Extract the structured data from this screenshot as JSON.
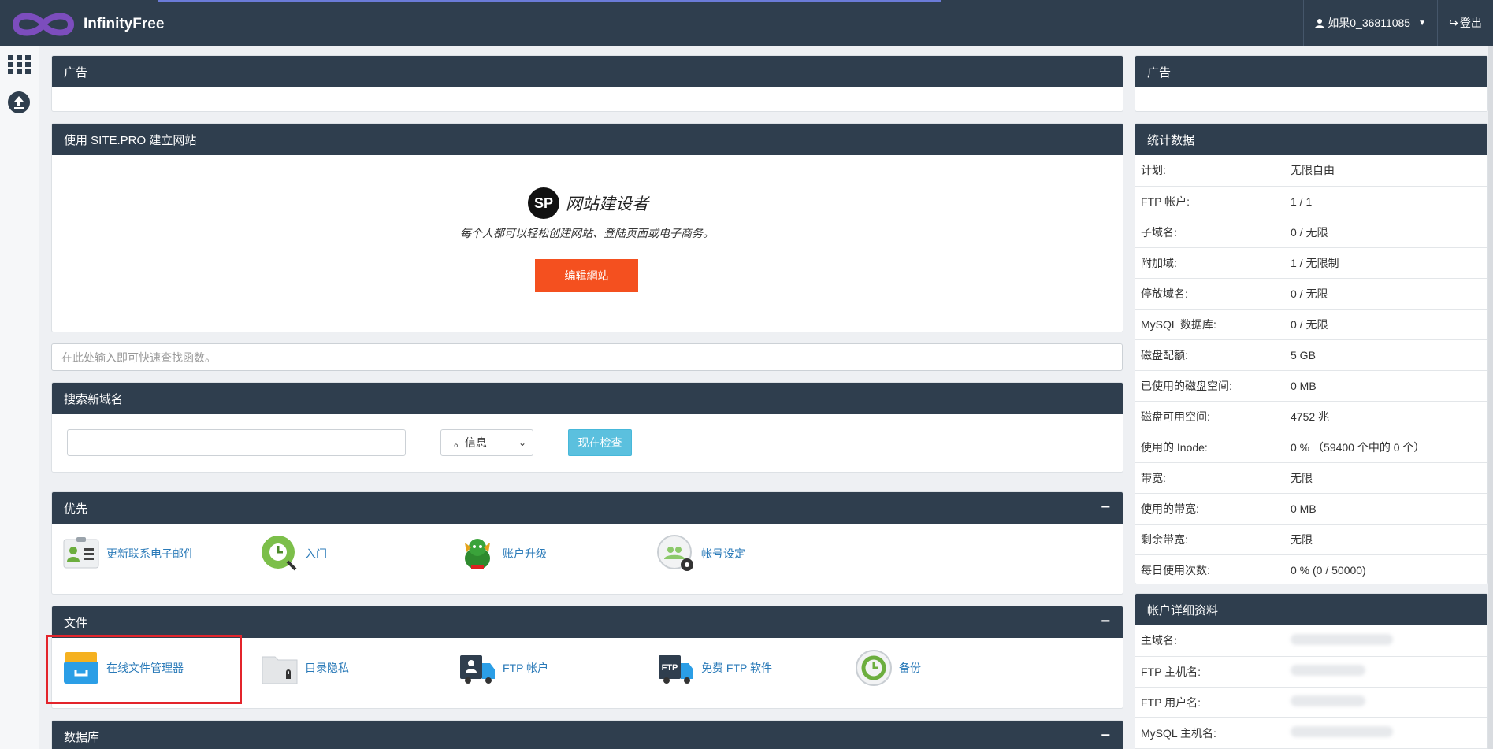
{
  "header": {
    "brand": "InfinityFree",
    "user": "如果0_36811085",
    "logout": "登出"
  },
  "ads_left": {
    "title": "广告"
  },
  "ads_right": {
    "title": "广告"
  },
  "sitepro": {
    "title": "使用 SITE.PRO 建立网站",
    "badge": "SP",
    "name": "网站建设者",
    "tagline": "每个人都可以轻松创建网站、登陆页面或电子商务。",
    "button": "编辑網站"
  },
  "quick_search": {
    "placeholder": "在此处输入即可快速查找函数。"
  },
  "domain_search": {
    "title": "搜索新域名",
    "input_value": "",
    "select_value": "。信息",
    "button": "现在检查"
  },
  "priority": {
    "title": "优先",
    "collapse": "−",
    "items": [
      {
        "label": "更新联系电子邮件",
        "icon": "contact-card-icon"
      },
      {
        "label": "入门",
        "icon": "getting-started-icon"
      },
      {
        "label": "账户升级",
        "icon": "dragon-upgrade-icon"
      },
      {
        "label": "帐号设定",
        "icon": "account-settings-icon"
      }
    ]
  },
  "files": {
    "title": "文件",
    "collapse": "−",
    "items": [
      {
        "label": "在线文件管理器",
        "icon": "file-manager-icon"
      },
      {
        "label": "目录隐私",
        "icon": "folder-lock-icon"
      },
      {
        "label": "FTP 帐户",
        "icon": "ftp-account-icon"
      },
      {
        "label": "免费 FTP 软件",
        "icon": "ftp-software-icon"
      },
      {
        "label": "备份",
        "icon": "backup-icon"
      }
    ]
  },
  "databases": {
    "title": "数据库",
    "collapse": "−"
  },
  "stats": {
    "title": "统计数据",
    "rows": [
      {
        "label": "计划:",
        "value": "无限自由"
      },
      {
        "label": "FTP 帐户:",
        "value": "1 / 1"
      },
      {
        "label": "子域名:",
        "value": "0 / 无限"
      },
      {
        "label": "附加域:",
        "value": "1 / 无限制"
      },
      {
        "label": "停放域名:",
        "value": "0 / 无限"
      },
      {
        "label": "MySQL 数据库:",
        "value": "0 / 无限"
      },
      {
        "label": "磁盘配额:",
        "value": "5 GB"
      },
      {
        "label": "已使用的磁盘空间:",
        "value": "0 MB"
      },
      {
        "label": "磁盘可用空间:",
        "value": "4752 兆"
      },
      {
        "label": "使用的 Inode:",
        "value": "0 % （59400 个中的 0 个）"
      },
      {
        "label": "带宽:",
        "value": "无限"
      },
      {
        "label": "使用的带宽:",
        "value": "0 MB"
      },
      {
        "label": "剩余带宽:",
        "value": "无限"
      },
      {
        "label": "每日使用次数:",
        "value": "0 % (0 / 50000)"
      }
    ]
  },
  "account_details": {
    "title": "帐户详细资料",
    "rows": [
      {
        "label": "主域名:"
      },
      {
        "label": "FTP 主机名:"
      },
      {
        "label": "FTP 用户名:"
      },
      {
        "label": "MySQL 主机名:"
      }
    ]
  },
  "colors": {
    "header_bg": "#2f3e4e",
    "link": "#2a7ab8",
    "sitepro_button": "#f4501f",
    "check_button": "#5bc0de",
    "highlight": "#e3242b"
  }
}
